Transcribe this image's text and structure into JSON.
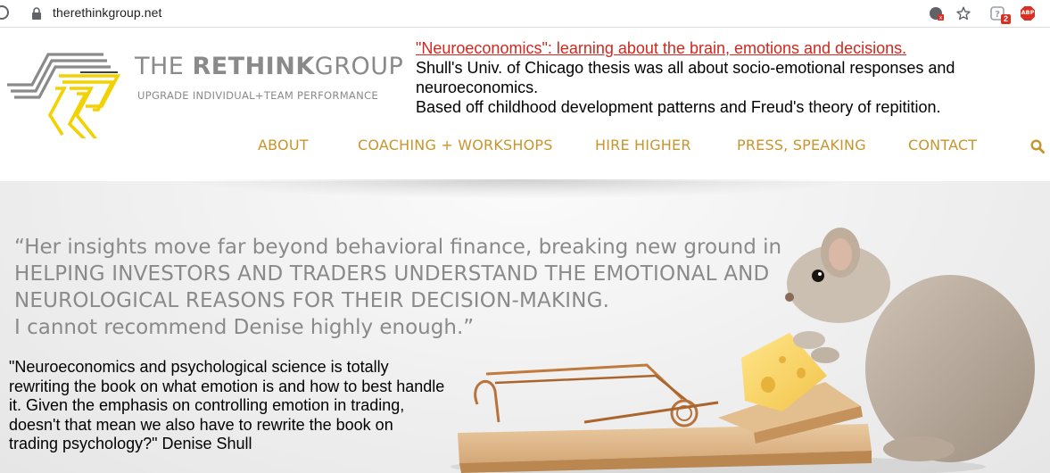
{
  "browser": {
    "url": "therethinkgroup.net",
    "extension_badge": "2",
    "abp_label": "ABP",
    "icons": [
      "reload-icon",
      "lock-icon",
      "translate-blocked-icon",
      "star-icon",
      "extension-icon",
      "adblock-icon"
    ]
  },
  "header": {
    "logo": {
      "name_prefix": "THE ",
      "name_bold": "RETHINK",
      "name_suffix": "GROUP",
      "tagline": "UPGRADE INDIVIDUAL+TEAM PERFORMANCE",
      "colors": {
        "gray": "#8a8a8a",
        "yellow": "#f2d200"
      }
    },
    "annotation": {
      "link": "\"Neuroeconomics\": learning about the brain, emotions and decisions. ",
      "line1": "Shull's Univ. of Chicago thesis was all about socio-emotional responses and",
      "line2": "neuroeconomics.",
      "line3": "Based off childhood development patterns and Freud's theory of repitition."
    },
    "nav": {
      "items": [
        "ABOUT",
        "COACHING + WORKSHOPS",
        "HIRE HIGHER",
        "PRESS, SPEAKING",
        "CONTACT"
      ],
      "color": "#c8952c",
      "search_icon": "search-icon"
    }
  },
  "hero": {
    "quote": {
      "line1": "“Her insights move far beyond behavioral finance, breaking new ground in",
      "line2": "HELPING INVESTORS AND TRADERS UNDERSTAND THE EMOTIONAL AND",
      "line3": "NEUROLOGICAL REASONS FOR THEIR DECISION-MAKING.",
      "line4": "I cannot recommend Denise highly enough.”"
    },
    "comment": "\"Neuroeconomics and psychological science is totally rewriting the book on what emotion is and how to best handle it. Given the emphasis on controlling emotion in trading, doesn't that mean we also have to rewrite the book on trading psychology?\" Denise Shull",
    "image": "mouse-and-mousetrap-with-cheese"
  }
}
